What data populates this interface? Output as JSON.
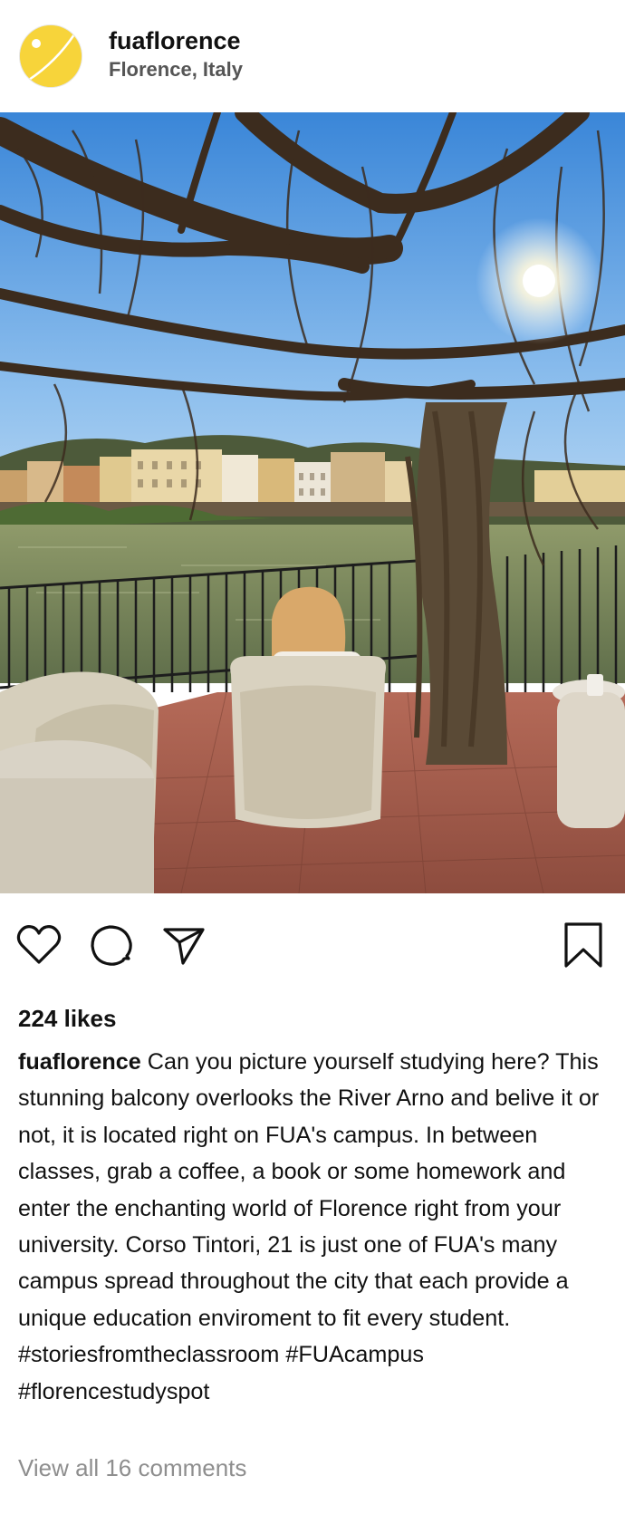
{
  "post": {
    "header": {
      "username": "fuaflorence",
      "location": "Florence, Italy",
      "avatar_icon": "tennis-ball-logo",
      "avatar_color": "#f7d43a"
    },
    "photo": {
      "description_icon": "photo-balcony-river-arno"
    },
    "actions": {
      "like_icon": "heart-icon",
      "comment_icon": "comment-icon",
      "share_icon": "send-icon",
      "save_icon": "bookmark-icon"
    },
    "likes_text": "224 likes",
    "caption": {
      "username": "fuaflorence",
      "text": "Can you picture yourself studying here? This stunning balcony overlooks the River Arno and belive it or not, it is located right on FUA's campus. In between classes, grab a coffee, a book or some homework and enter the enchanting world of Florence right from your university. Corso Tintori, 21 is just one of FUA's many campus spread throughout the city that each provide a unique education enviroment to fit every student.",
      "hashtags": [
        "#storiesfromtheclassroom",
        "#FUAcampus",
        "#florencestudyspot"
      ]
    },
    "view_comments": "View all 16 comments"
  }
}
